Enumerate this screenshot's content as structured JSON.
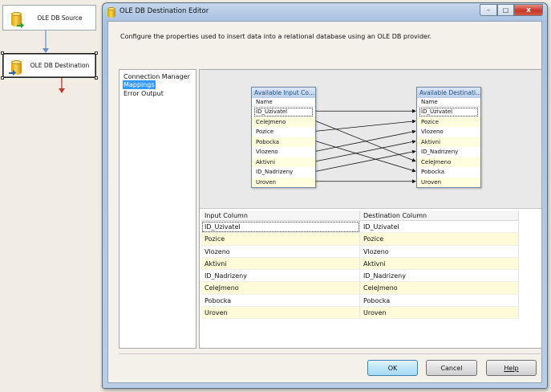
{
  "designer": {
    "source_task": "OLE DB Source",
    "dest_task": "OLE DB Destination"
  },
  "dialog": {
    "title": "OLE DB Destination Editor",
    "description": "Configure the properties used to insert data into a relational database using an OLE DB provider.",
    "controls": {
      "minimize": "–",
      "maximize": "□",
      "close": "x"
    }
  },
  "nav": {
    "items": [
      {
        "label": "Connection Manager"
      },
      {
        "label": "Mappings",
        "selected": true
      },
      {
        "label": "Error Output"
      }
    ]
  },
  "mapping": {
    "input_table": {
      "title": "Available Input Co...",
      "header": "Name",
      "columns": [
        "ID_Uzivatel",
        "CeleJmeno",
        "Pozice",
        "Pobocka",
        "Vlozeno",
        "Aktivni",
        "ID_Nadrizeny",
        "Uroven"
      ]
    },
    "dest_table": {
      "title": "Available Destinati...",
      "header": "Name",
      "columns": [
        "ID_Uzivatel",
        "Pozice",
        "Vlozeno",
        "Aktivni",
        "ID_Nadrizeny",
        "CeleJmeno",
        "Pobocka",
        "Uroven"
      ]
    },
    "links": [
      [
        0,
        0
      ],
      [
        1,
        5
      ],
      [
        2,
        1
      ],
      [
        3,
        6
      ],
      [
        4,
        2
      ],
      [
        5,
        3
      ],
      [
        6,
        4
      ],
      [
        7,
        7
      ]
    ]
  },
  "grid": {
    "headers": [
      "Input Column",
      "Destination Column"
    ],
    "rows": [
      [
        "ID_Uzivatel",
        "ID_Uzivatel"
      ],
      [
        "Pozice",
        "Pozice"
      ],
      [
        "Vlozeno",
        "Vlozeno"
      ],
      [
        "Aktivni",
        "Aktivni"
      ],
      [
        "ID_Nadrizeny",
        "ID_Nadrizeny"
      ],
      [
        "CeleJmeno",
        "CeleJmeno"
      ],
      [
        "Pobocka",
        "Pobocka"
      ],
      [
        "Uroven",
        "Uroven"
      ]
    ]
  },
  "buttons": {
    "ok": "OK",
    "cancel": "Cancel",
    "help": "Help"
  },
  "colors": {
    "selection": "#3399ff",
    "row_alt": "#fffbd9",
    "arrow_red": "#c0392b",
    "connector_blue": "#6a8ec4"
  }
}
